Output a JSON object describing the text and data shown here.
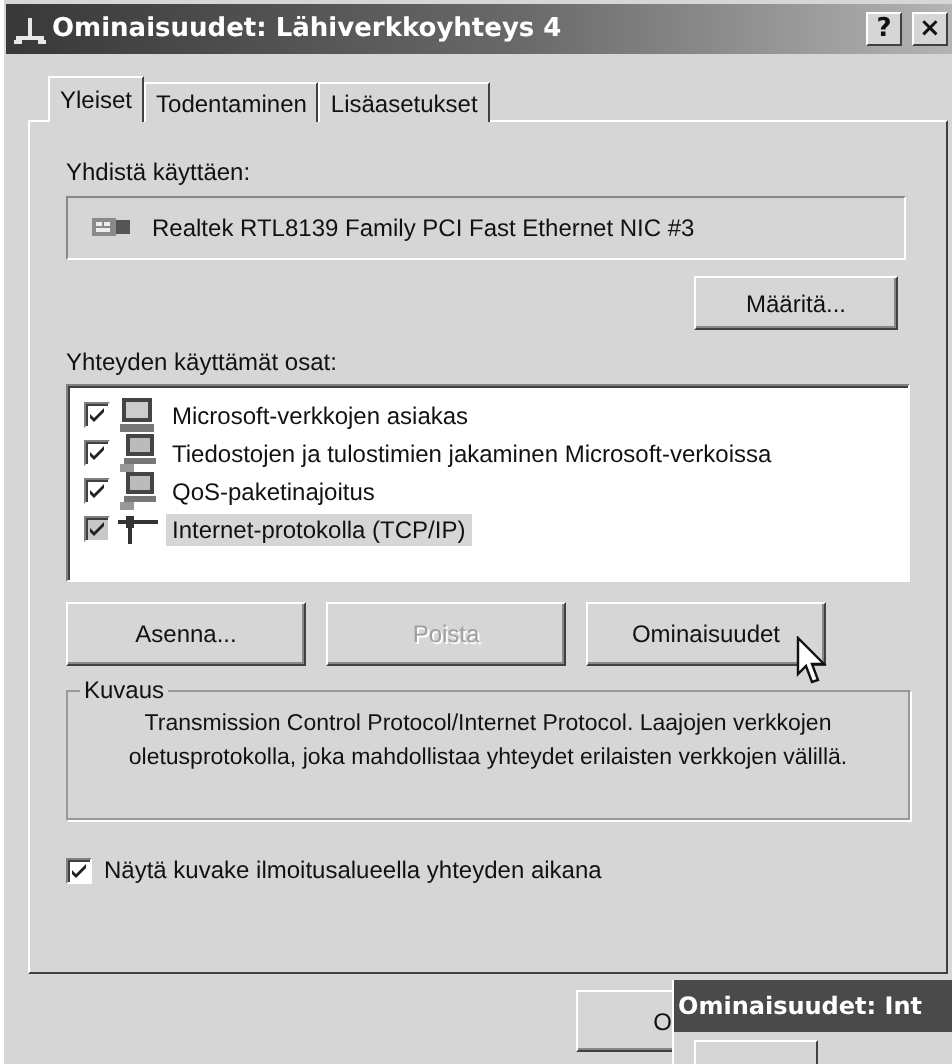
{
  "window": {
    "title": "Ominaisuudet: Lähiverkkoyhteys 4",
    "title_buttons": [
      "?",
      "×"
    ]
  },
  "tabs": [
    {
      "label": "Yleiset",
      "selected": true
    },
    {
      "label": "Todentaminen",
      "selected": false
    },
    {
      "label": "Lisäasetukset",
      "selected": false
    }
  ],
  "connect_using": {
    "label": "Yhdistä käyttäen:",
    "adapter": "Realtek RTL8139 Family PCI Fast Ethernet NIC #3",
    "button": "Määritä..."
  },
  "components": {
    "label": "Yhteyden käyttämät osat:",
    "items": [
      {
        "name": "Microsoft-verkkojen asiakas",
        "checked": true,
        "selected": false,
        "kind": "client"
      },
      {
        "name": "Tiedostojen ja tulostimien jakaminen Microsoft-verkoissa",
        "checked": true,
        "selected": false,
        "kind": "service"
      },
      {
        "name": "QoS-paketinajoitus",
        "checked": true,
        "selected": false,
        "kind": "service"
      },
      {
        "name": "Internet-protokolla (TCP/IP)",
        "checked": true,
        "selected": true,
        "kind": "protocol"
      }
    ]
  },
  "buttons": [
    {
      "label": "Asenna...",
      "disabled": false
    },
    {
      "label": "Poista",
      "disabled": true
    },
    {
      "label": "Ominaisuudet",
      "disabled": false
    }
  ],
  "description": {
    "legend": "Kuvaus",
    "text": "Transmission Control Protocol/Internet Protocol. Laajojen verkkojen oletusprotokolla, joka mahdollistaa yhteydet erilaisten verkkojen välillä."
  },
  "show_icon": {
    "label": "Näytä kuvake ilmoitusalueella yhteyden aikana",
    "checked": true
  },
  "footer_buttons": [
    "O"
  ],
  "overlapping_window": {
    "title": "Ominaisuudet: Int"
  }
}
